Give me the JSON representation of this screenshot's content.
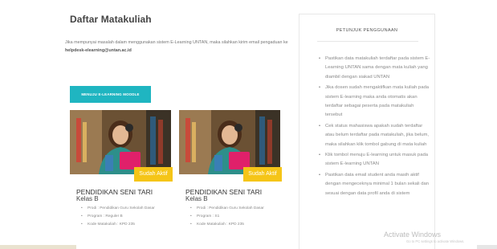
{
  "page": {
    "title": "Daftar Matakuliah",
    "notice": "Jika mempunyai masalah dalam menggunakan sistem E-Learning UNTAN, maka silahkan kirim email pengaduan ke",
    "email": "helpdesk-elearning@untan.ac.id",
    "moodle_button": "MENUJU E-LEARNING MOODLE"
  },
  "courses": [
    {
      "badge": "Sudah Aktif",
      "name": "PENDIDIKAN SENI TARI",
      "class": "Kelas B",
      "details": [
        "Prodi : Pendidikan Guru Sekolah Dasar",
        "Program : Reguler B",
        "Kode Matakuliah : KPD 235"
      ]
    },
    {
      "badge": "Sudah Aktif",
      "name": "PENDIDIKAN SENI TARI",
      "class": "Kelas B",
      "details": [
        "Prodi : Pendidikan Guru Sekolah Dasar",
        "Program : S1",
        "Kode Matakuliah : KPD 235"
      ]
    }
  ],
  "sidebar": {
    "title": "PETUNJUK PENGGUNAAN",
    "tips": [
      "Pastikan data matakuliah terdaftar pada sistem E-Learning UNTAN sama dengan mata kuliah yang diambil dengan siakad UNTAN",
      "Jika dosen sudah mengaktifkan mata kuliah pada sistem E-learning maka anda otomatis akan terdaftar sebagai peserta pada matakuliah tersebut",
      "Cek status mahasiswa apakah sudah terdaftar atau belum terdaftar pada matakuliah, jika belum, maka silahkan klik tombol gabung di mata kuliah",
      "Klik tombol menuju E-learning untuk masuk pada sistem E-learning UNTAN",
      "Pastikan data email student anda masih aktif dengan mengeceknya minimal 1 bulan sekali dan sesuai dengan data profil anda di sistem"
    ]
  },
  "watermark": {
    "title": "Activate Windows",
    "subtitle": "Go to PC settings to activate Windows."
  },
  "colors": {
    "accent": "#1fb5c1",
    "badge": "#f5c518"
  }
}
